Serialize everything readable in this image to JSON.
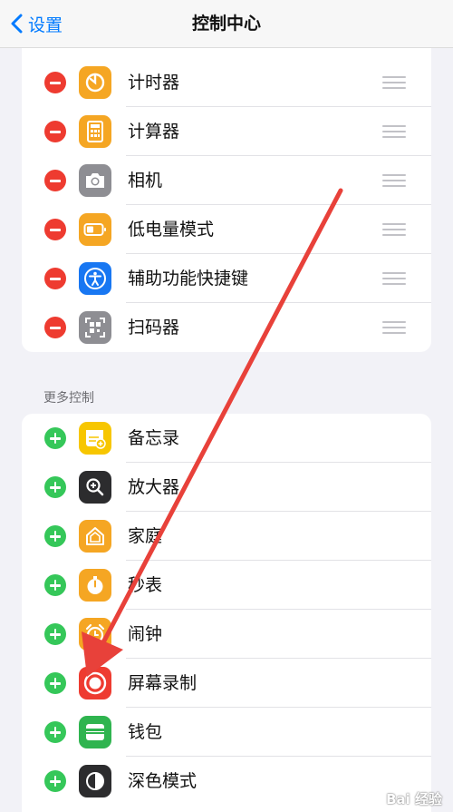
{
  "navbar": {
    "back_label": "设置",
    "title": "控制中心"
  },
  "included_controls": [
    {
      "label": "计时器",
      "icon": "timer-icon",
      "color": "#f5a623"
    },
    {
      "label": "计算器",
      "icon": "calculator-icon",
      "color": "#f5a623"
    },
    {
      "label": "相机",
      "icon": "camera-icon",
      "color": "#8e8e93"
    },
    {
      "label": "低电量模式",
      "icon": "battery-icon",
      "color": "#f5a623"
    },
    {
      "label": "辅助功能快捷键",
      "icon": "accessibility-icon",
      "color": "#1877f2"
    },
    {
      "label": "扫码器",
      "icon": "qr-code-icon",
      "color": "#8e8e93"
    }
  ],
  "more_controls": {
    "header": "更多控制",
    "items": [
      {
        "label": "备忘录",
        "icon": "notes-icon",
        "color": "#f7c600"
      },
      {
        "label": "放大器",
        "icon": "magnifier-icon",
        "color": "#2c2c2e"
      },
      {
        "label": "家庭",
        "icon": "home-icon",
        "color": "#f5a623"
      },
      {
        "label": "秒表",
        "icon": "stopwatch-icon",
        "color": "#f5a623"
      },
      {
        "label": "闹钟",
        "icon": "alarm-icon",
        "color": "#f5a623"
      },
      {
        "label": "屏幕录制",
        "icon": "screen-record-icon",
        "color": "#ee3b30"
      },
      {
        "label": "钱包",
        "icon": "wallet-icon",
        "color": "#2fb44f"
      },
      {
        "label": "深色模式",
        "icon": "dark-mode-icon",
        "color": "#2c2c2e"
      }
    ]
  },
  "colors": {
    "accent": "#007aff",
    "remove": "#ee3b30",
    "add": "#35c759",
    "annotation_arrow": "#e8413a"
  },
  "watermark": "Bai 经验"
}
